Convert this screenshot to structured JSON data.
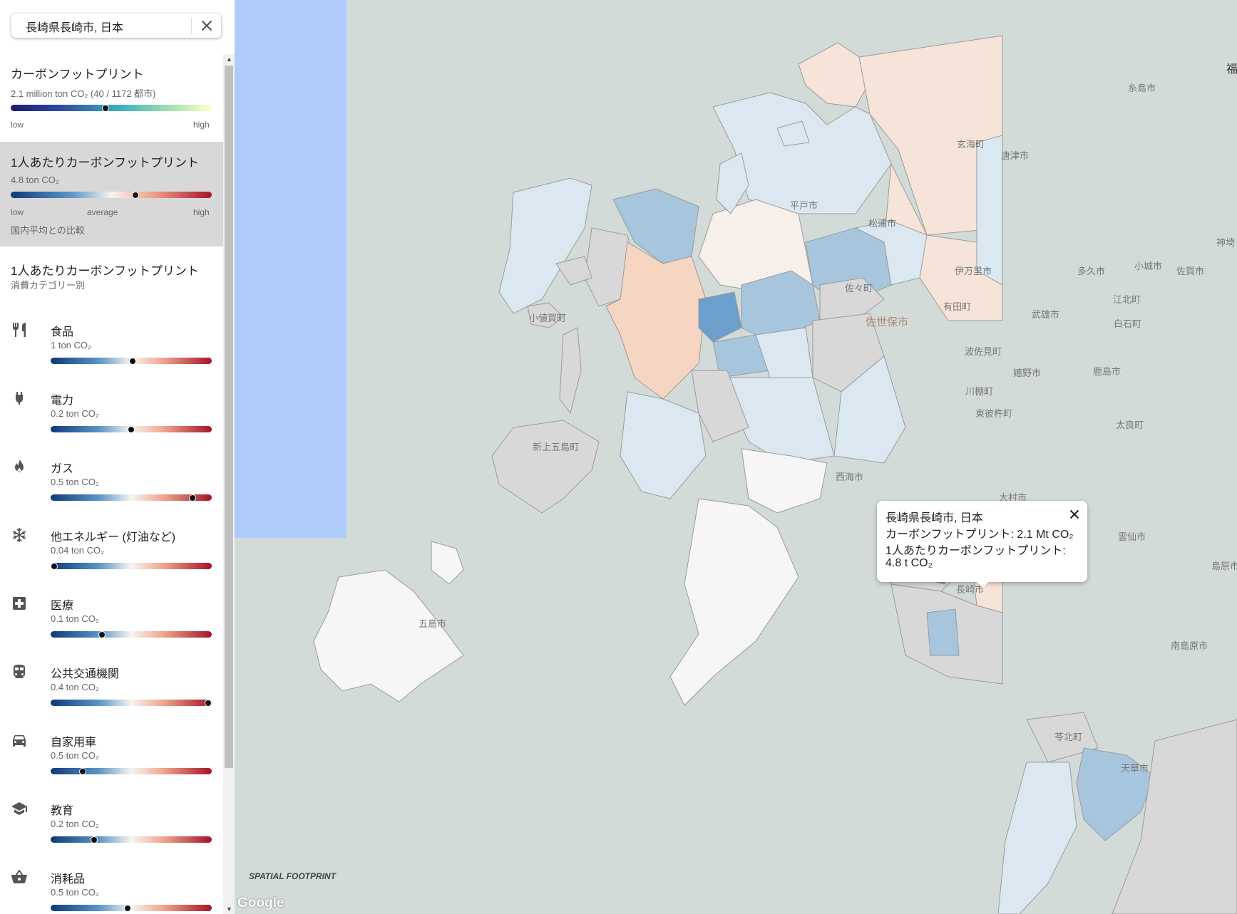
{
  "search": {
    "value": "長崎県長崎市, 日本",
    "clear_icon": "close-icon"
  },
  "sidebar": {
    "total": {
      "title": "カーボンフットプリント",
      "value_line": "2.1 million ton CO₂ (40 / 1172 都市)",
      "low_label": "low",
      "high_label": "high",
      "position": 0.47
    },
    "per_capita": {
      "title": "1人あたりカーボンフットプリント",
      "value": "4.8 ton CO₂",
      "low_label": "low",
      "average_label": "average",
      "high_label": "high",
      "note": "国内平均との比較",
      "position": 0.62
    },
    "categories_header": {
      "title": "1人あたりカーボンフットプリント",
      "subtitle": "消費カテゴリー別"
    },
    "categories": [
      {
        "name": "食品",
        "value": "1 ton CO₂",
        "icon": "fork-knife-icon",
        "position": 0.51
      },
      {
        "name": "電力",
        "value": "0.2 ton CO₂",
        "icon": "plug-icon",
        "position": 0.5
      },
      {
        "name": "ガス",
        "value": "0.5 ton CO₂",
        "icon": "flame-icon",
        "position": 0.88
      },
      {
        "name": "他エネルギー (灯油など)",
        "value": "0.04 ton CO₂",
        "icon": "snowflake-icon",
        "position": 0.02
      },
      {
        "name": "医療",
        "value": "0.1 ton CO₂",
        "icon": "medical-cross-icon",
        "position": 0.32
      },
      {
        "name": "公共交通機関",
        "value": "0.4 ton CO₂",
        "icon": "train-icon",
        "position": 0.98
      },
      {
        "name": "自家用車",
        "value": "0.5 ton CO₂",
        "icon": "car-icon",
        "position": 0.2
      },
      {
        "name": "教育",
        "value": "0.2 ton CO₂",
        "icon": "graduation-cap-icon",
        "position": 0.27
      },
      {
        "name": "消耗品",
        "value": "0.5 ton CO₂",
        "icon": "shopping-basket-icon",
        "position": 0.48
      }
    ]
  },
  "map": {
    "places": {
      "itoshima": "糸島市",
      "genkai": "玄海町",
      "karatsu": "唐津市",
      "fukuoka": "福",
      "hirado": "平戸市",
      "matsuura": "松浦市",
      "imari": "伊万里市",
      "taku": "多久市",
      "ogi": "小城市",
      "saga": "佐賀市",
      "kanzaki": "神埼",
      "sasa": "佐々町",
      "ojika": "小値賀町",
      "arita": "有田町",
      "takeo": "武雄市",
      "kohoku": "江北町",
      "shiroishi": "白石町",
      "sasebo": "佐世保市",
      "hasami": "波佐見町",
      "ureshino": "嬉野市",
      "kashima": "鹿島市",
      "kawatana": "川棚町",
      "higashisonogi": "東彼杵町",
      "tara": "太良町",
      "shinkamigoto": "新上五島町",
      "saikai": "西海市",
      "omura": "大村市",
      "unzen": "雲仙市",
      "shimabara": "島原市",
      "goto": "五島市",
      "nagasaki": "長崎市",
      "minamishimabara": "南島原市",
      "reihoku": "苓北町",
      "amakusa": "天草市"
    },
    "colors": {
      "ocean": "#aecbfa",
      "land_neutral": "#f6f6f6",
      "no_data": "#d8d8d8",
      "light_blue": "#dce8f1",
      "mid_blue": "#a7c6de",
      "strong_blue": "#6c9fcb",
      "light_orange": "#f7e4d8",
      "orange": "#f6d5c2"
    }
  },
  "popup": {
    "title": "長崎県長崎市, 日本",
    "line1": "カーボンフットプリント: 2.1 Mt CO₂",
    "line2": "1人あたりカーボンフットプリント:",
    "line3": "4.8 t CO₂",
    "close_icon": "close-icon"
  },
  "brand": "SPATIAL FOOTPRINT",
  "map_attribution": "Google"
}
